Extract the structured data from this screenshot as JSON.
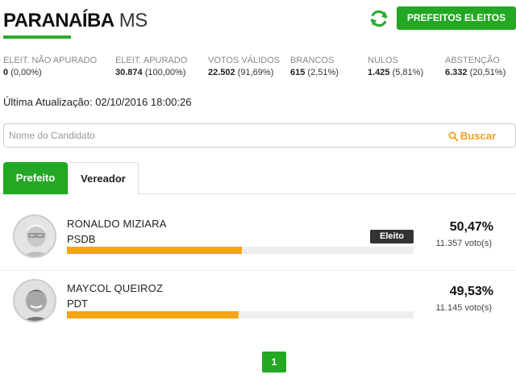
{
  "header": {
    "city": "PARANAÍBA",
    "state": "MS",
    "eleitos_button": "PREFEITOS ELEITOS"
  },
  "stats": [
    {
      "label": "ELEIT. NÃO APURADO",
      "value": "0",
      "pct": "(0,00%)"
    },
    {
      "label": "ELEIT. APURADO",
      "value": "30.874",
      "pct": "(100,00%)"
    },
    {
      "label": "VOTOS VÁLIDOS",
      "value": "22.502",
      "pct": "(91,69%)"
    },
    {
      "label": "BRANCOS",
      "value": "615",
      "pct": "(2,51%)"
    },
    {
      "label": "NULOS",
      "value": "1.425",
      "pct": "(5,81%)"
    },
    {
      "label": "ABSTENÇÃO",
      "value": "6.332",
      "pct": "(20,51%)"
    }
  ],
  "update": {
    "label": "Última Atualização:",
    "datetime": "02/10/2016 18:00:26"
  },
  "search": {
    "placeholder": "Nome do Candidato",
    "button": "Buscar"
  },
  "tabs": [
    {
      "label": "Prefeito",
      "active": true
    },
    {
      "label": "Vereador",
      "active": false
    }
  ],
  "candidates": [
    {
      "name": "RONALDO MIZIARA",
      "party": "PSDB",
      "percent": "50,47%",
      "share": 0.5047,
      "votes": "11.357 voto(s)",
      "badge": "Eleito"
    },
    {
      "name": "MAYCOL QUEIROZ",
      "party": "PDT",
      "percent": "49,53%",
      "share": 0.4953,
      "votes": "11.145 voto(s)",
      "badge": ""
    }
  ],
  "pagination": {
    "current": "1"
  },
  "colors": {
    "accent": "#23a823",
    "bar": "#f5a50f",
    "search_button": "#f0a020",
    "badge": "#333333"
  }
}
